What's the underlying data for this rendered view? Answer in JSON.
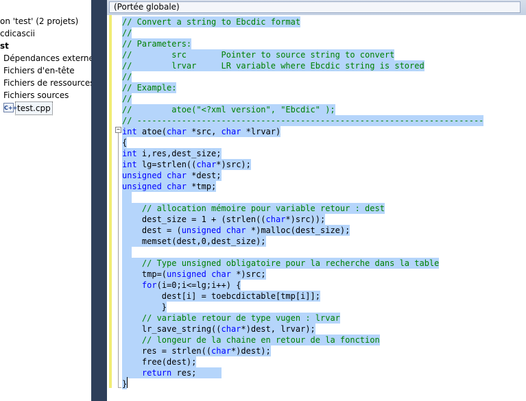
{
  "explorer": {
    "items": [
      {
        "label": "on 'test' (2 projets)",
        "bold": false
      },
      {
        "label": "cdicascii",
        "bold": false
      },
      {
        "label": "st",
        "bold": true
      },
      {
        "label": "Dépendances externes",
        "bold": false
      },
      {
        "label": "Fichiers d'en-tête",
        "bold": false
      },
      {
        "label": "Fichiers de ressources",
        "bold": false
      },
      {
        "label": "Fichiers sources",
        "bold": false
      },
      {
        "label": "test.cpp",
        "bold": false,
        "icon": "cpp-file-icon",
        "icon_text": "C++"
      }
    ]
  },
  "scope_bar": {
    "selected": "(Portée globale)"
  },
  "colors": {
    "selection": "#b5d5fb",
    "comment": "#008000",
    "keyword": "#0000ff",
    "change_bar": "#f1ec74",
    "divider": "#2e3f5a"
  },
  "code_lines": [
    [
      {
        "t": "// Convert a string to Ebcdic format",
        "c": "cm"
      }
    ],
    [
      {
        "t": "//",
        "c": "cm"
      }
    ],
    [
      {
        "t": "// Parameters:",
        "c": "cm"
      }
    ],
    [
      {
        "t": "//        src       Pointer to source string to convert",
        "c": "cm"
      }
    ],
    [
      {
        "t": "//        lrvar     LR variable where Ebcdic string is stored",
        "c": "cm"
      }
    ],
    [
      {
        "t": "//",
        "c": "cm"
      }
    ],
    [
      {
        "t": "// Example:",
        "c": "cm"
      }
    ],
    [
      {
        "t": "//",
        "c": "cm"
      }
    ],
    [
      {
        "t": "//        atoe(\"<?xml version\", \"Ebcdic\" );",
        "c": "cm"
      }
    ],
    [
      {
        "t": "// ----------------------------------------------------------------------",
        "c": "cm"
      }
    ],
    [
      {
        "t": "int",
        "c": "kw"
      },
      {
        "t": " atoe("
      },
      {
        "t": "char",
        "c": "kw"
      },
      {
        "t": " *src, "
      },
      {
        "t": "char",
        "c": "kw"
      },
      {
        "t": " *lrvar)"
      }
    ],
    [
      {
        "t": "{"
      }
    ],
    [
      {
        "t": "int",
        "c": "kw"
      },
      {
        "t": " i,res,dest_size;"
      }
    ],
    [
      {
        "t": "int",
        "c": "kw"
      },
      {
        "t": " lg=strlen(("
      },
      {
        "t": "char",
        "c": "kw"
      },
      {
        "t": "*)src);"
      }
    ],
    [
      {
        "t": "unsigned",
        "c": "kw"
      },
      {
        "t": " "
      },
      {
        "t": "char",
        "c": "kw"
      },
      {
        "t": " *dest;"
      }
    ],
    [
      {
        "t": "unsigned",
        "c": "kw"
      },
      {
        "t": " "
      },
      {
        "t": "char",
        "c": "kw"
      },
      {
        "t": " *tmp;"
      }
    ],
    [
      {
        "t": "  "
      }
    ],
    [
      {
        "t": "    "
      },
      {
        "t": "// allocation mémoire pour variable retour : dest",
        "c": "cm"
      }
    ],
    [
      {
        "t": "    dest_size = 1 + (strlen(("
      },
      {
        "t": "char",
        "c": "kw"
      },
      {
        "t": "*)src));"
      }
    ],
    [
      {
        "t": "    dest = ("
      },
      {
        "t": "unsigned",
        "c": "kw"
      },
      {
        "t": " "
      },
      {
        "t": "char",
        "c": "kw"
      },
      {
        "t": " *)malloc(dest_size);"
      }
    ],
    [
      {
        "t": "    memset(dest,0,dest_size);"
      }
    ],
    [
      {
        "t": "  "
      }
    ],
    [
      {
        "t": "    "
      },
      {
        "t": "// Type unsigned obligatoire pour la recherche dans la table",
        "c": "cm"
      }
    ],
    [
      {
        "t": "    tmp=("
      },
      {
        "t": "unsigned",
        "c": "kw"
      },
      {
        "t": " "
      },
      {
        "t": "char",
        "c": "kw"
      },
      {
        "t": " *)src;"
      }
    ],
    [
      {
        "t": "    "
      },
      {
        "t": "for",
        "c": "kw"
      },
      {
        "t": "(i=0;i<=lg;i++) {"
      }
    ],
    [
      {
        "t": "        dest[i] = toebcdictable[tmp[i]];"
      }
    ],
    [
      {
        "t": "        }"
      }
    ],
    [
      {
        "t": "    "
      },
      {
        "t": "// variable retour de type vugen : lrvar",
        "c": "cm"
      }
    ],
    [
      {
        "t": "    lr_save_string(("
      },
      {
        "t": "char",
        "c": "kw"
      },
      {
        "t": "*)dest, lrvar);"
      }
    ],
    [
      {
        "t": "    "
      },
      {
        "t": "// longeur de la chaine en retour de la fonction",
        "c": "cm"
      }
    ],
    [
      {
        "t": "    res = strlen(("
      },
      {
        "t": "char",
        "c": "kw"
      },
      {
        "t": "*)dest);"
      }
    ],
    [
      {
        "t": "    free(dest);"
      }
    ],
    [
      {
        "t": "    "
      },
      {
        "t": "return",
        "c": "kw"
      },
      {
        "t": " res;"
      },
      {
        "t": "     "
      }
    ],
    [
      {
        "t": "}"
      }
    ]
  ]
}
